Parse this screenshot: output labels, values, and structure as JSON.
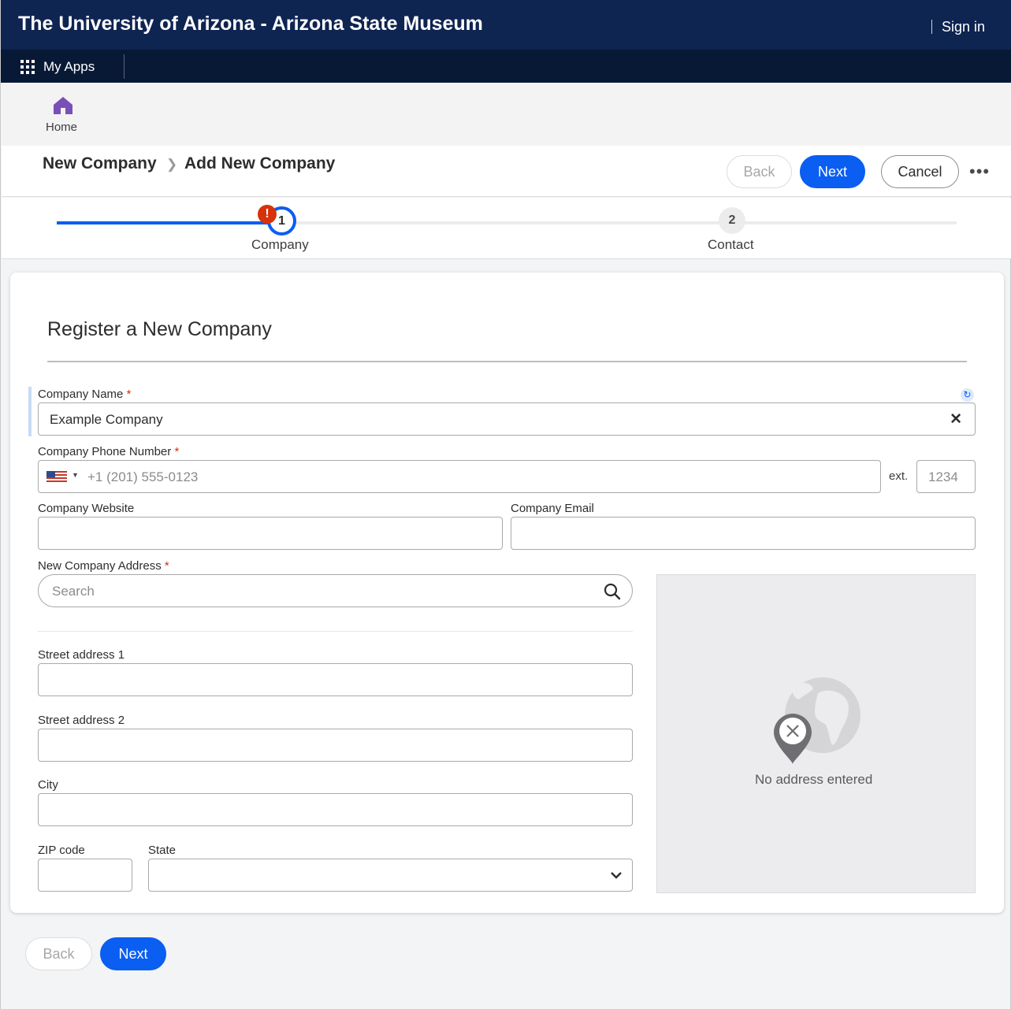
{
  "site": {
    "title": "The University of Arizona - Arizona State Museum",
    "sign_in": "Sign in"
  },
  "appbar": {
    "my_apps": "My Apps"
  },
  "home": {
    "label": "Home"
  },
  "header": {
    "breadcrumb": [
      "New Company",
      "Add New Company"
    ],
    "back_label": "Back",
    "next_label": "Next",
    "cancel_label": "Cancel",
    "more_label": "•••"
  },
  "stepper": {
    "steps": [
      {
        "number": "1",
        "label": "Company",
        "state": "active",
        "error": true
      },
      {
        "number": "2",
        "label": "Contact",
        "state": "pending"
      }
    ],
    "error_glyph": "!"
  },
  "form": {
    "title": "Register a New Company",
    "company_name": {
      "label": "Company Name",
      "required_mark": "*",
      "value": "Example Company"
    },
    "phone": {
      "label": "Company Phone Number",
      "required_mark": "*",
      "placeholder": "+1 (201) 555-0123",
      "ext_label": "ext.",
      "ext_placeholder": "1234"
    },
    "website": {
      "label": "Company Website",
      "value": ""
    },
    "email": {
      "label": "Company Email",
      "value": ""
    },
    "address": {
      "label": "New Company Address",
      "required_mark": "*",
      "search_placeholder": "Search"
    },
    "street1": {
      "label": "Street address 1",
      "value": ""
    },
    "street2": {
      "label": "Street address 2",
      "value": ""
    },
    "city": {
      "label": "City",
      "value": ""
    },
    "zip": {
      "label": "ZIP code",
      "value": ""
    },
    "state": {
      "label": "State",
      "value": ""
    },
    "map_message": "No address entered"
  },
  "footer": {
    "back_label": "Back",
    "next_label": "Next"
  },
  "colors": {
    "topbar": "#0e2451",
    "appbar": "#081936",
    "accent": "#0a5ef2",
    "error": "#d6320b",
    "home_icon": "#7b4fb8"
  }
}
